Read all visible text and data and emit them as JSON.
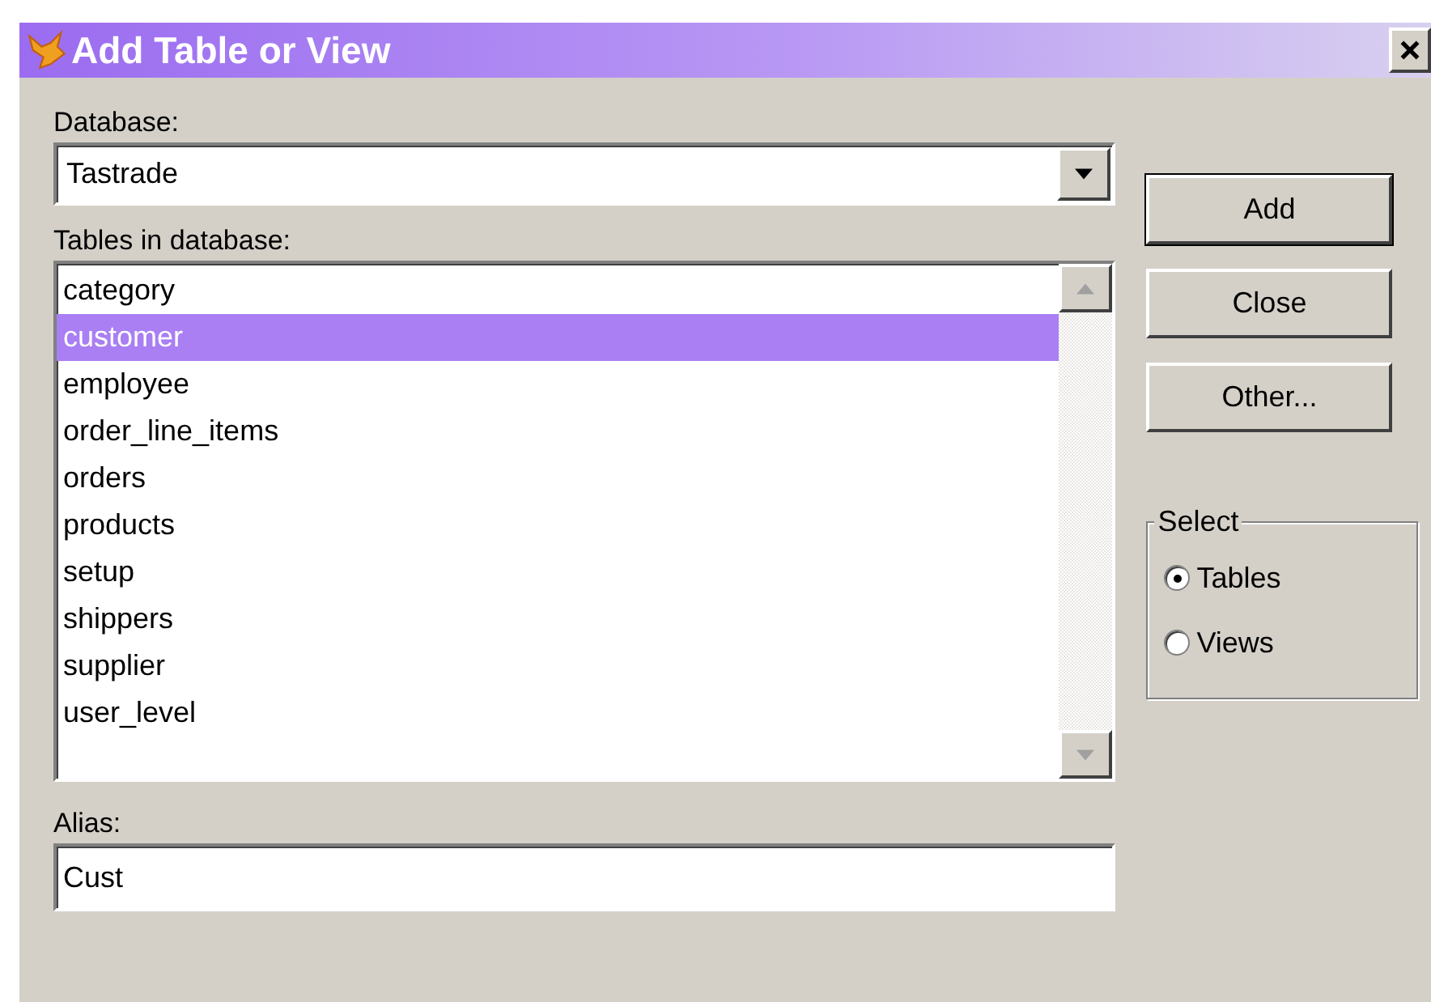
{
  "window": {
    "title": "Add Table or View"
  },
  "database": {
    "label": "Database:",
    "value": "Tastrade"
  },
  "tables": {
    "label": "Tables in database:",
    "items": [
      {
        "name": "category",
        "selected": false
      },
      {
        "name": "customer",
        "selected": true
      },
      {
        "name": "employee",
        "selected": false
      },
      {
        "name": "order_line_items",
        "selected": false
      },
      {
        "name": "orders",
        "selected": false
      },
      {
        "name": "products",
        "selected": false
      },
      {
        "name": "setup",
        "selected": false
      },
      {
        "name": "shippers",
        "selected": false
      },
      {
        "name": "supplier",
        "selected": false
      },
      {
        "name": "user_level",
        "selected": false
      }
    ]
  },
  "alias": {
    "label": "Alias:",
    "value": "Cust"
  },
  "buttons": [
    {
      "label": "Add",
      "default": true
    },
    {
      "label": "Close",
      "default": false
    },
    {
      "label": "Other...",
      "default": false
    }
  ],
  "select": {
    "label": "Select",
    "options": [
      {
        "label": "Tables",
        "selected": true
      },
      {
        "label": "Views",
        "selected": false
      }
    ]
  }
}
